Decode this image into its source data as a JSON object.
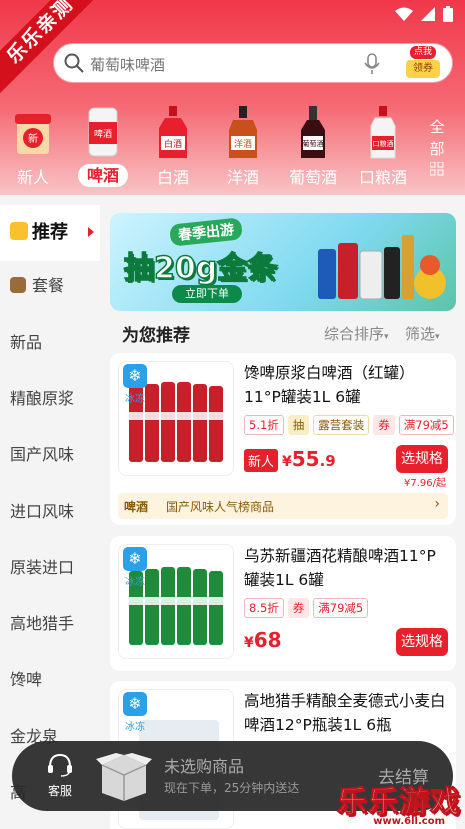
{
  "watermark_ribbon": "乐乐亲测",
  "search": {
    "placeholder": "葡萄味啤酒",
    "coupon_top": "点我",
    "coupon_bottom": "领券"
  },
  "categories": [
    {
      "label": "新人",
      "icon": "new-user-gift-icon"
    },
    {
      "label": "啤酒",
      "icon": "beer-can-icon",
      "active": true
    },
    {
      "label": "白酒",
      "icon": "baijiu-bottle-icon"
    },
    {
      "label": "洋酒",
      "icon": "whisky-bottle-icon"
    },
    {
      "label": "葡萄酒",
      "icon": "wine-bottle-icon"
    },
    {
      "label": "口粮酒",
      "icon": "liquor-bottle-icon"
    }
  ],
  "category_bottle_labels": [
    "新",
    "啤酒",
    "白酒",
    "洋酒",
    "葡萄酒",
    "口粮酒"
  ],
  "all_categories": "全部",
  "sidebar": [
    "推荐",
    "套餐",
    "新品",
    "精酿原浆",
    "国产风味",
    "进口风味",
    "原装进口",
    "高地猎手",
    "馋啤",
    "金龙泉",
    "高"
  ],
  "banner": {
    "headline_top": "春季出游",
    "headline_main": "抽20g金条",
    "cta": "立即下单"
  },
  "recommend": {
    "title": "为您推荐",
    "sort": "综合排序",
    "filter": "筛选"
  },
  "products": [
    {
      "title": "馋啤原浆白啤酒（红罐）11°P罐装1L 6罐",
      "frozen": "冰冻",
      "tags": [
        "5.1折",
        "抽",
        "露营套装",
        "券",
        "满79减5"
      ],
      "new_badge": "新人",
      "currency": "¥",
      "price_int": "55",
      "price_dec": ".9",
      "button": "选规格",
      "unit_price": "¥7.96/起",
      "rank_category": "啤酒",
      "rank_text": "国产风味人气榜商品",
      "can_color": "#c8202a",
      "can_label": "原浆"
    },
    {
      "title": "乌苏新疆酒花精酿啤酒11°P罐装1L 6罐",
      "frozen": "冰冻",
      "tags": [
        "8.5折",
        "券",
        "满79减5"
      ],
      "currency": "¥",
      "price_int": "68",
      "button": "选规格",
      "can_color": "#1e8a3a",
      "can_label": "WUSU"
    },
    {
      "title": "高地猎手精酿全麦德式小麦白啤酒12°P瓶装1L 6瓶",
      "frozen": "冰冻"
    }
  ],
  "cart": {
    "service": "客服",
    "title": "未选购商品",
    "subtitle": "现在下单，25分钟内送达",
    "checkout": "去结算"
  },
  "site_watermark": "乐乐游戏",
  "site_url": "www.6ll.com",
  "colors": {
    "primary": "#e8202e",
    "header": "#f0384a",
    "frozen": "#2aa0e8"
  }
}
